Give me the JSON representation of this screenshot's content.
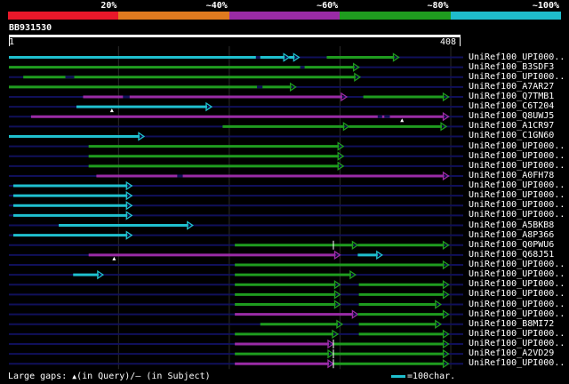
{
  "legend": {
    "bands": [
      {
        "label": "20%",
        "color": "#e8182a"
      },
      {
        "label": "~40%",
        "color": "#e07a1f"
      },
      {
        "label": "~60%",
        "color": "#9a2ba6"
      },
      {
        "label": "~80%",
        "color": "#1f9c1f"
      },
      {
        "label": "~100%",
        "color": "#1fbccc"
      }
    ]
  },
  "query": {
    "id": "BB931530",
    "start": "1",
    "end": "408",
    "length": 408
  },
  "colors": {
    "cyan": "#1fc0cf",
    "green": "#1f9c1f",
    "magenta": "#9a2ba6",
    "navy": "#10105a",
    "grid": "#2a2a2a"
  },
  "hits": [
    {
      "label": "UniRef100_UPI000..",
      "segs": [
        [
          1,
          254,
          "cyan"
        ],
        [
          254,
          263,
          "cyan"
        ],
        [
          288,
          353,
          "green"
        ]
      ],
      "gaps": [
        [
          224,
          228
        ]
      ]
    },
    {
      "label": "UniRef100_B3SDF3",
      "segs": [
        [
          1,
          317,
          "green"
        ]
      ],
      "gaps": [
        [
          264,
          268
        ]
      ]
    },
    {
      "label": "UniRef100_UPI000..",
      "segs": [
        [
          14,
          318,
          "green"
        ]
      ],
      "gaps": [
        [
          52,
          60
        ]
      ]
    },
    {
      "label": "UniRef100_A7AR27",
      "segs": [
        [
          1,
          260,
          "green"
        ]
      ],
      "gaps": [
        [
          225,
          230
        ]
      ]
    },
    {
      "label": "UniRef100_Q7TMB1",
      "segs": [
        [
          68,
          306,
          "magenta"
        ],
        [
          321,
          398,
          "green"
        ]
      ],
      "gaps": [
        [
          104,
          110
        ]
      ]
    },
    {
      "label": "UniRef100_C6T204",
      "segs": [
        [
          62,
          184,
          "cyan"
        ]
      ],
      "gaps": [],
      "marks": [
        [
          94,
          "q"
        ]
      ]
    },
    {
      "label": "UniRef100_Q8UWJ5",
      "segs": [
        [
          21,
          398,
          "magenta"
        ]
      ],
      "gaps": [
        [
          334,
          338
        ],
        [
          340,
          345
        ]
      ],
      "marks": [
        [
          356,
          "q"
        ]
      ]
    },
    {
      "label": "UniRef100_A1CR97",
      "segs": [
        [
          194,
          308,
          "green"
        ],
        [
          308,
          396,
          "green"
        ]
      ],
      "gaps": []
    },
    {
      "label": "UniRef100_C1GN60",
      "segs": [
        [
          1,
          123,
          "cyan"
        ]
      ],
      "gaps": []
    },
    {
      "label": "UniRef100_UPI000..",
      "segs": [
        [
          73,
          303,
          "green"
        ]
      ],
      "gaps": []
    },
    {
      "label": "UniRef100_UPI000..",
      "segs": [
        [
          73,
          303,
          "green"
        ]
      ],
      "gaps": []
    },
    {
      "label": "UniRef100_UPI000..",
      "segs": [
        [
          73,
          303,
          "green"
        ]
      ],
      "gaps": []
    },
    {
      "label": "UniRef100_A0FH78",
      "segs": [
        [
          80,
          398,
          "magenta"
        ]
      ],
      "gaps": [
        [
          153,
          158
        ]
      ]
    },
    {
      "label": "UniRef100_UPI000..",
      "segs": [
        [
          5,
          112,
          "cyan"
        ]
      ],
      "gaps": []
    },
    {
      "label": "UniRef100_UPI000..",
      "segs": [
        [
          5,
          112,
          "cyan"
        ]
      ],
      "gaps": []
    },
    {
      "label": "UniRef100_UPI000..",
      "segs": [
        [
          5,
          112,
          "cyan"
        ]
      ],
      "gaps": []
    },
    {
      "label": "UniRef100_UPI000..",
      "segs": [
        [
          5,
          112,
          "cyan"
        ]
      ],
      "gaps": []
    },
    {
      "label": "UniRef100_A5BKB8",
      "segs": [
        [
          46,
          167,
          "cyan"
        ]
      ],
      "gaps": []
    },
    {
      "label": "UniRef100_A8P366",
      "segs": [
        [
          5,
          112,
          "cyan"
        ]
      ],
      "gaps": []
    },
    {
      "label": "UniRef100_Q0PWU6",
      "segs": [
        [
          205,
          316,
          "green"
        ],
        [
          316,
          398,
          "green"
        ]
      ],
      "gaps": [],
      "divs": [
        294
      ]
    },
    {
      "label": "UniRef100_Q68J51",
      "segs": [
        [
          73,
          300,
          "magenta"
        ],
        [
          316,
          338,
          "cyan"
        ]
      ],
      "gaps": [],
      "marks": [
        [
          96,
          "q"
        ]
      ]
    },
    {
      "label": "UniRef100_UPI000..",
      "segs": [
        [
          205,
          398,
          "green"
        ]
      ],
      "gaps": []
    },
    {
      "label": "UniRef100_UPI000..",
      "segs": [
        [
          59,
          86,
          "cyan"
        ],
        [
          205,
          314,
          "green"
        ]
      ],
      "gaps": []
    },
    {
      "label": "UniRef100_UPI000..",
      "segs": [
        [
          205,
          300,
          "green"
        ],
        [
          317,
          398,
          "green"
        ]
      ],
      "gaps": []
    },
    {
      "label": "UniRef100_UPI000..",
      "segs": [
        [
          205,
          300,
          "green"
        ],
        [
          317,
          398,
          "green"
        ]
      ],
      "gaps": []
    },
    {
      "label": "UniRef100_UPI000..",
      "segs": [
        [
          205,
          300,
          "green"
        ],
        [
          317,
          391,
          "green"
        ]
      ],
      "gaps": []
    },
    {
      "label": "UniRef100_UPI000..",
      "segs": [
        [
          205,
          316,
          "magenta"
        ],
        [
          316,
          398,
          "green"
        ]
      ],
      "gaps": []
    },
    {
      "label": "UniRef100_B8MI72",
      "segs": [
        [
          228,
          302,
          "green"
        ],
        [
          317,
          391,
          "green"
        ]
      ],
      "gaps": []
    },
    {
      "label": "UniRef100_UPI000..",
      "segs": [
        [
          205,
          298,
          "green"
        ],
        [
          317,
          398,
          "green"
        ]
      ],
      "gaps": []
    },
    {
      "label": "UniRef100_UPI000..",
      "segs": [
        [
          205,
          294,
          "magenta"
        ],
        [
          294,
          398,
          "green"
        ]
      ],
      "gaps": [],
      "divs": [
        294
      ]
    },
    {
      "label": "UniRef100_A2VD29",
      "segs": [
        [
          205,
          294,
          "green"
        ],
        [
          294,
          398,
          "green"
        ]
      ],
      "gaps": [],
      "divs": [
        294
      ]
    },
    {
      "label": "UniRef100_UPI000..",
      "segs": [
        [
          205,
          294,
          "magenta"
        ],
        [
          294,
          398,
          "green"
        ]
      ],
      "gaps": [],
      "divs": [
        294
      ]
    }
  ],
  "footer": {
    "gaps_text": "Large gaps: ",
    "query_mark": "▲",
    "query_text": "(in Query)/",
    "subject_mark": "–",
    "subject_text": " (in Subject)",
    "key_text": "=100char."
  }
}
